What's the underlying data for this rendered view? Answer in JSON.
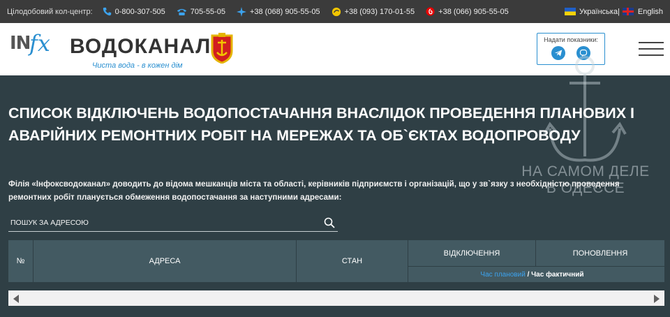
{
  "topbar": {
    "call_center_label": "Цілодобовий кол-центр:",
    "phones": [
      {
        "icon": "phone-icon",
        "number": "0-800-307-505"
      },
      {
        "icon": "landline-icon",
        "number": "705-55-05"
      },
      {
        "icon": "kyivstar-icon",
        "number": "+38 (068) 905-55-05"
      },
      {
        "icon": "lifecell-icon",
        "number": "+38 (093) 170-01-55"
      },
      {
        "icon": "vodafone-icon",
        "number": "+38 (066) 905-55-05"
      }
    ],
    "lang_ua": "Українська",
    "lang_sep": "|",
    "lang_en": "English"
  },
  "header": {
    "logo_in": "IN",
    "logo_fx": "fx",
    "logo_name": "ВОДОКАНАЛ",
    "logo_tagline": "Чиста вода - в кожен дім",
    "meter_title": "Надати показники:",
    "meter_icons": [
      "telegram-icon",
      "viber-icon"
    ]
  },
  "main": {
    "title": "Список відключень водопостачання внаслідок проведення планових і аварійних ремонтних робіт на мережах та об`єктах водопроводу",
    "notice": "Філія «Інфоксводоканал» доводить до відома мешканців міста та області, керівників підприємств і організацій, що у зв`язку з необхідністю проведення ремонтних робіт планується обмеження водопостачання за наступними адресами:",
    "search_placeholder": "ПОШУК ЗА АДРЕСОЮ"
  },
  "table": {
    "columns": [
      "№",
      "АДРЕСА",
      "СТАН",
      "ВІДКЛЮЧЕННЯ",
      "ПОНОВЛЕННЯ"
    ],
    "legend_planned": "Час плановий",
    "legend_sep": " / ",
    "legend_actual": "Час фактичний"
  },
  "watermark": {
    "line1": "НА САМОМ ДЕЛЕ",
    "line2": "В ОДЕССЕ"
  },
  "colors": {
    "topbar_bg": "#3b3b3b",
    "page_bg": "#2f3f45",
    "table_header_bg": "#435a62",
    "accent": "#2a8fd0",
    "link": "#3ca3ee"
  }
}
